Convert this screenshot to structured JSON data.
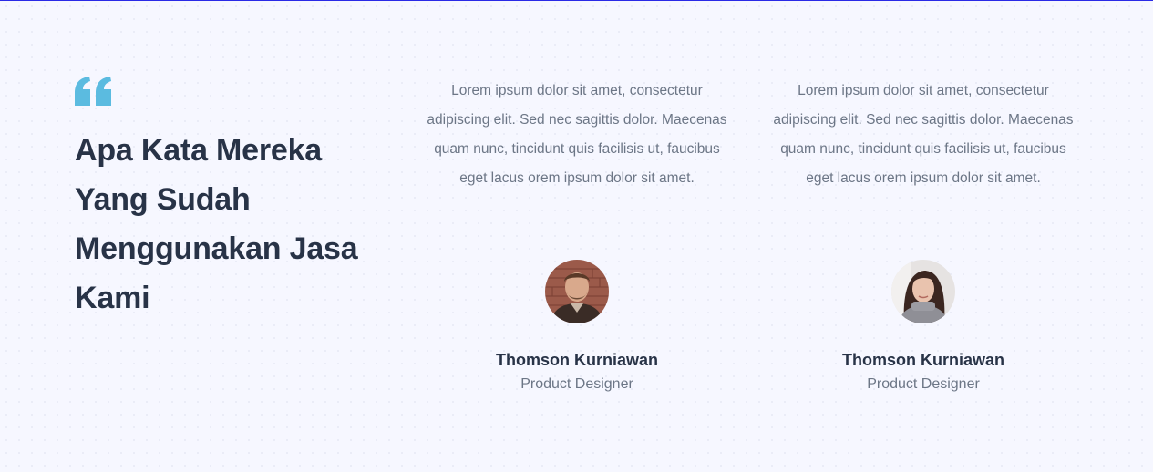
{
  "section": {
    "heading": "Apa Kata Mereka Yang Sudah Menggunakan Jasa Kami",
    "accent_color": "#5bbbe0",
    "quote_icon": "quote-icon"
  },
  "testimonials": [
    {
      "text": "Lorem ipsum dolor sit amet, consectetur adipiscing elit. Sed nec sagittis dolor. Maecenas quam nunc, tincidunt quis facilisis ut, faucibus eget lacus orem ipsum dolor sit amet.",
      "name": "Thomson Kurniawan",
      "role": "Product Designer",
      "avatar": "man-portrait"
    },
    {
      "text": "Lorem ipsum dolor sit amet, consectetur adipiscing elit. Sed nec sagittis dolor. Maecenas quam nunc, tincidunt quis facilisis ut, faucibus eget lacus orem ipsum dolor sit amet.",
      "name": "Thomson Kurniawan",
      "role": "Product Designer",
      "avatar": "woman-portrait"
    }
  ]
}
